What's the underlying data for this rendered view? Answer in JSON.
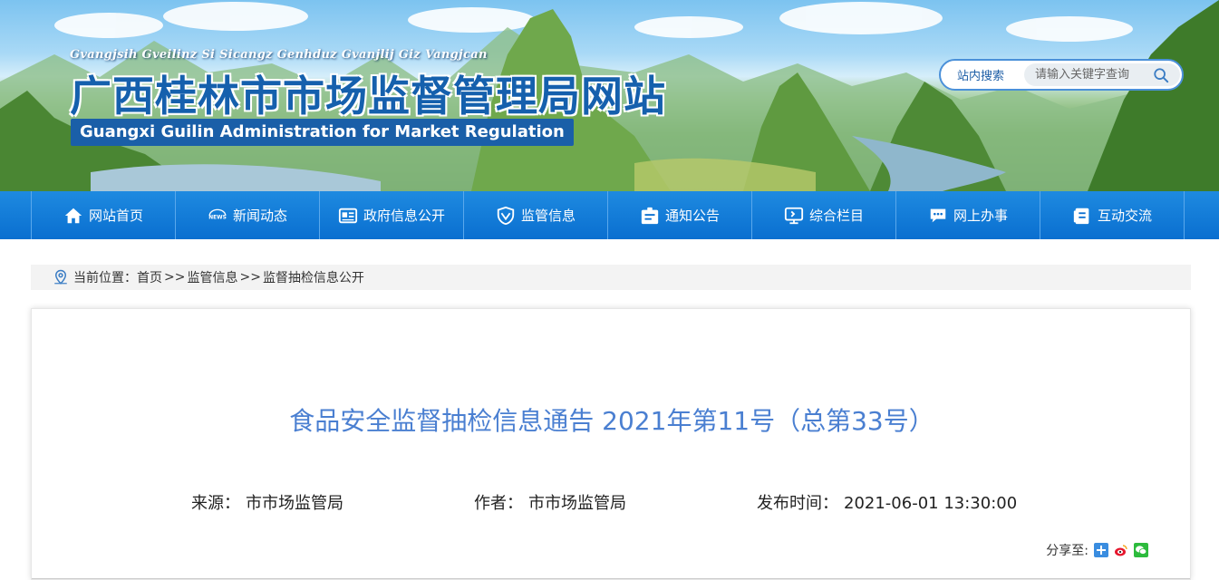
{
  "header": {
    "zhuang_name": "Gvangjsih Gveilinz Si Sicangz Genhduz Gvanjlij Giz Vangjcan",
    "site_title": "广西桂林市市场监督管理局网站",
    "site_title_en": "Guangxi Guilin Administration for Market Regulation",
    "search": {
      "label": "站内搜索",
      "placeholder": "请输入关键字查询"
    }
  },
  "nav": {
    "items": [
      {
        "label": "网站首页",
        "icon": "home-icon"
      },
      {
        "label": "新闻动态",
        "icon": "news-icon"
      },
      {
        "label": "政府信息公开",
        "icon": "gov-info-icon"
      },
      {
        "label": "监管信息",
        "icon": "shield-icon"
      },
      {
        "label": "通知公告",
        "icon": "notice-icon"
      },
      {
        "label": "综合栏目",
        "icon": "monitor-icon"
      },
      {
        "label": "网上办事",
        "icon": "chat-icon"
      },
      {
        "label": "互动交流",
        "icon": "document-icon"
      }
    ]
  },
  "breadcrumb": {
    "prefix": "当前位置：",
    "items": [
      "首页",
      "监管信息",
      "监督抽检信息公开"
    ],
    "separator": ">>"
  },
  "article": {
    "title": "食品安全监督抽检信息通告 2021年第11号（总第33号）",
    "source_label": "来源：",
    "source": "市市场监管局",
    "author_label": "作者：",
    "author": "市市场监管局",
    "time_label": "发布时间：",
    "time": "2021-06-01 13:30:00",
    "share_label": "分享至:"
  },
  "colors": {
    "nav": "#0a6fd0",
    "title": "#4a7fd1",
    "brand_dark": "#1560ad"
  }
}
